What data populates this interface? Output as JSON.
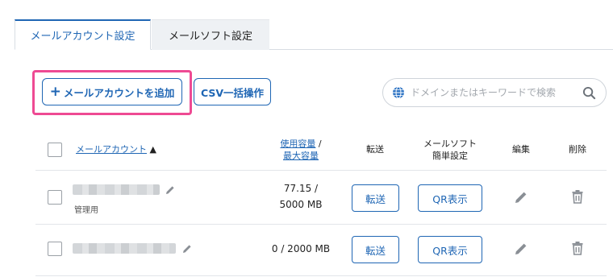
{
  "tabs": {
    "account": "メールアカウント設定",
    "software": "メールソフト設定"
  },
  "actions": {
    "add_account_label": "メールアカウントを追加",
    "add_account_plus": "+",
    "csv_label": "CSV一括操作"
  },
  "search": {
    "placeholder": "ドメインまたはキーワードで検索",
    "value": ""
  },
  "table": {
    "headers": {
      "account": "メールアカウント",
      "account_sort": "▲",
      "usage_line1": "使用容量",
      "usage_sep": " /",
      "usage_line2": "最大容量",
      "forward": "転送",
      "software_line1": "メールソフト",
      "software_line2": "簡単設定",
      "edit": "編集",
      "delete": "削除"
    },
    "rows": [
      {
        "sublabel": "管理用",
        "usage_line1": "77.15 /",
        "usage_line2": "5000 MB",
        "forward_label": "転送",
        "qr_label": "QR表示"
      },
      {
        "sublabel": "",
        "usage_line1": "0 / 2000 MB",
        "usage_line2": "",
        "forward_label": "転送",
        "qr_label": "QR表示"
      }
    ]
  },
  "colors": {
    "accent": "#1f66b4",
    "highlight": "#ee4a93"
  }
}
